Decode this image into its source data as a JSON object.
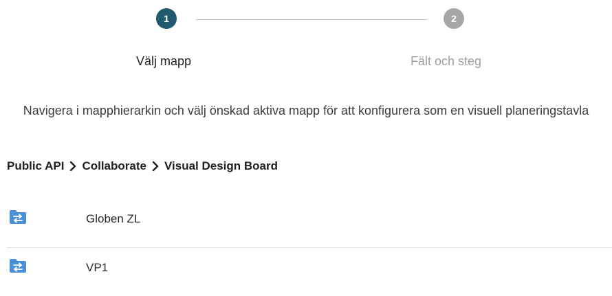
{
  "stepper": {
    "steps": [
      {
        "number": "1",
        "label": "Välj mapp",
        "state": "active",
        "color": "#1f5a6e"
      },
      {
        "number": "2",
        "label": "Fält och steg",
        "state": "inactive",
        "color": "#a6a6a6"
      }
    ]
  },
  "instructions": "Navigera i mapphierarkin och välj önskad aktiva mapp för att konfigurera som en visuell planeringstavla",
  "breadcrumb": {
    "items": [
      "Public API",
      "Collaborate",
      "Visual Design Board"
    ],
    "separator_icon": "chevron-right-icon"
  },
  "folders": {
    "icon": "shared-folder-icon",
    "icon_color": "#4a90d9",
    "items": [
      {
        "name": "Globen ZL"
      },
      {
        "name": "VP1"
      }
    ]
  }
}
